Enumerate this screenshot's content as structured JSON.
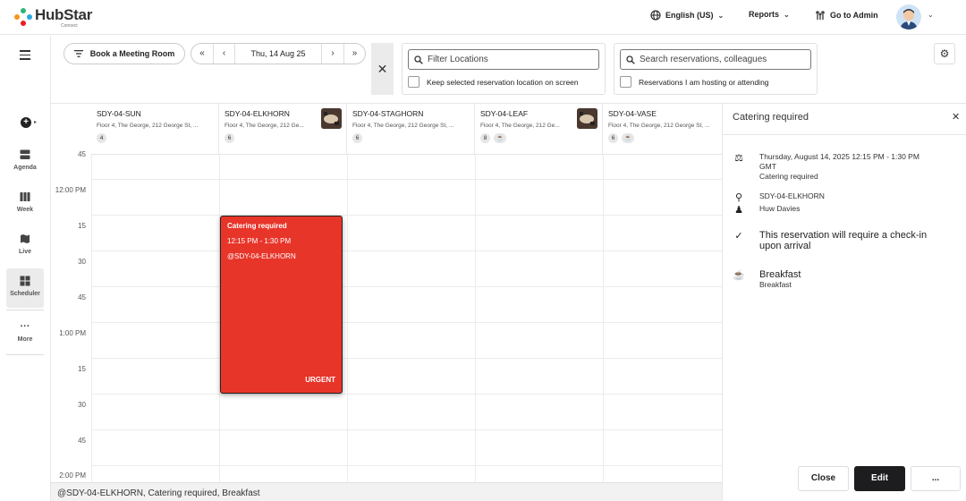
{
  "header": {
    "brand": "HubStar",
    "brand_sub": "Connect",
    "language": "English (US)",
    "reports": "Reports",
    "go_to_admin": "Go to Admin"
  },
  "nav": {
    "items": [
      {
        "label": "Agenda",
        "icon": "agenda-icon"
      },
      {
        "label": "Week",
        "icon": "week-icon"
      },
      {
        "label": "Live",
        "icon": "map-icon"
      },
      {
        "label": "Scheduler",
        "icon": "scheduler-icon"
      },
      {
        "label": "More",
        "icon": "more-icon"
      }
    ],
    "active": "Scheduler"
  },
  "toolbar": {
    "book_label": "Book a Meeting Room",
    "date": "Thu, 14 Aug 25",
    "filter_placeholder": "Filter Locations",
    "keep_location_label": "Keep selected reservation location on screen",
    "search_placeholder": "Search reservations, colleagues",
    "hosting_label": "Reservations I am hosting or attending"
  },
  "columns": [
    {
      "name": "SDY-04-SUN",
      "address": "Floor 4, The George, 212 George St, ...",
      "capacity": "4",
      "catering": false,
      "thumb": false
    },
    {
      "name": "SDY-04-ELKHORN",
      "address": "Floor 4, The George, 212 Ge...",
      "capacity": "6",
      "catering": false,
      "thumb": true
    },
    {
      "name": "SDY-04-STAGHORN",
      "address": "Floor 4, The George, 212 George St, ...",
      "capacity": "6",
      "catering": false,
      "thumb": false
    },
    {
      "name": "SDY-04-LEAF",
      "address": "Floor 4, The George, 212 Ge...",
      "capacity": "8",
      "catering": true,
      "thumb": true
    },
    {
      "name": "SDY-04-VASE",
      "address": "Floor 4, The George, 212 George St, ...",
      "capacity": "6",
      "catering": true,
      "thumb": false
    }
  ],
  "times": [
    "45",
    "12:00 PM",
    "15",
    "30",
    "45",
    "1:00 PM",
    "15",
    "30",
    "45",
    "2:00 PM"
  ],
  "event": {
    "title": "Catering required",
    "time": "12:15 PM - 1:30 PM",
    "room": "@SDY-04-ELKHORN",
    "tag": "URGENT",
    "color": "#e8352a"
  },
  "footer_text": "@SDY-04-ELKHORN, Catering required, Breakfast",
  "panel": {
    "title": "Catering required",
    "datetime_line1": "Thursday, August 14, 2025 12:15 PM - 1:30 PM",
    "datetime_line2": "GMT",
    "subtitle": "Catering required",
    "room": "SDY-04-ELKHORN",
    "person": "Huw Davies",
    "checkin_line1": "This reservation will require a check-in",
    "checkin_line2": "upon arrival",
    "catering_title": "Breakfast",
    "catering_sub": "Breakfast",
    "close_label": "Close",
    "edit_label": "Edit",
    "more_label": "..."
  }
}
